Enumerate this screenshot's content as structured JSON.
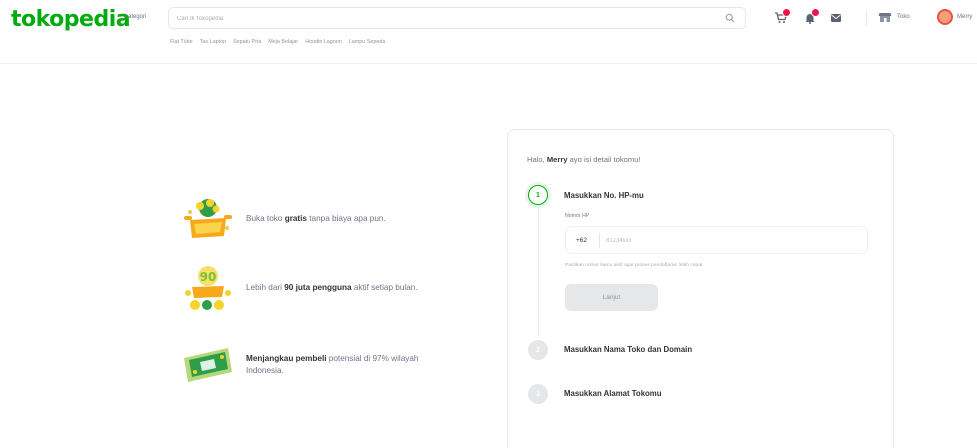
{
  "header": {
    "logo": "tokopedia",
    "kategori": "Kategori",
    "search_placeholder": "Cari di Tokopedia",
    "suggestions": [
      "Flat Tübe",
      "Tas Laptop",
      "Sepatu Pria",
      "Meja Belajar",
      "Hoodie Lagoon",
      "Lampu Sepeda"
    ],
    "store_label": "Toko",
    "user_label": "Merry"
  },
  "benefits": [
    {
      "pre": "Buka toko ",
      "bold": "gratis",
      "post": " tanpa biaya apa pun."
    },
    {
      "pre": "Lebih dari ",
      "bold": "90 juta pengguna",
      "post": " aktif setiap bulan."
    },
    {
      "pre": "",
      "bold": "Menjangkau pembeli",
      "post": " potensial di 97% wilayah Indonesia."
    }
  ],
  "card": {
    "greeting_pre": "Halo, ",
    "greeting_name": "Merry",
    "greeting_post": " ayo isi detail tokomu!",
    "steps": [
      {
        "number": "1",
        "title": "Masukkan No. HP-mu"
      },
      {
        "number": "2",
        "title": "Masukkan Nama Toko dan Domain"
      },
      {
        "number": "3",
        "title": "Masukkan Alamat Tokomu"
      }
    ],
    "phone_label": "Nomor HP",
    "phone_prefix": "+62",
    "phone_placeholder": "81234xxx",
    "hint": "Pastikan nomor kamu aktif agar proses pendaftaran lebih cepat",
    "next_button": "Lanjut"
  },
  "colors": {
    "brand": "#03ac0e",
    "badge": "#ef144a"
  }
}
